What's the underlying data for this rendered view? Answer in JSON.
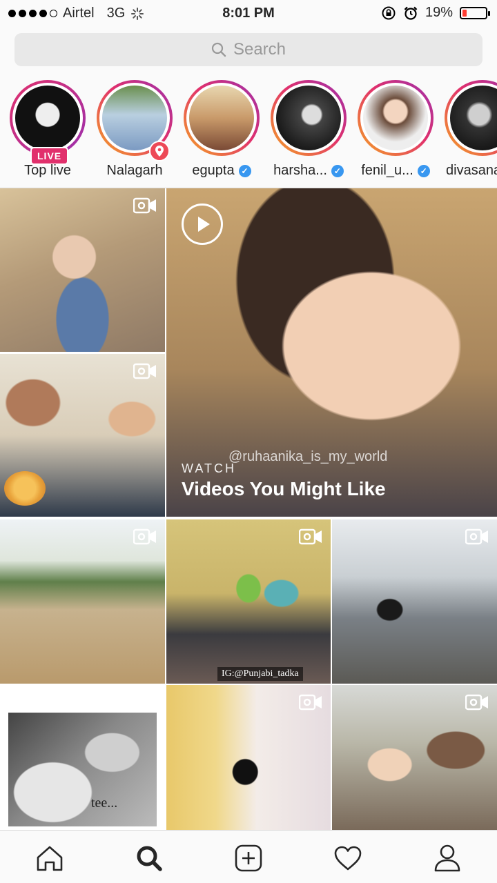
{
  "status_bar": {
    "carrier": "Airtel",
    "network": "3G",
    "time": "8:01 PM",
    "battery_percent": "19%",
    "battery_level": 0.19,
    "signal_bars_filled": 4,
    "signal_bars_total": 5
  },
  "search": {
    "placeholder": "Search"
  },
  "stories": [
    {
      "label": "Top live",
      "badge": "LIVE",
      "verified": false
    },
    {
      "label": "Nalagarh",
      "badge": "location-pin-icon",
      "verified": false
    },
    {
      "label": "egupta",
      "verified": true
    },
    {
      "label": "harsha...",
      "verified": true
    },
    {
      "label": "fenil_u...",
      "verified": true
    },
    {
      "label": "divasana",
      "verified": false
    }
  ],
  "grid": {
    "featured": {
      "kicker": "WATCH",
      "title": "Videos You Might Like",
      "watermark": "@ruhaanika_is_my_world"
    },
    "tile_tags": {
      "punjabi": "IG:@Punjabi_tadka",
      "dog_caption": "tee..."
    }
  },
  "tab_bar": {
    "icons": [
      "home-icon",
      "search-icon",
      "add-post-icon",
      "activity-heart-icon",
      "profile-icon"
    ],
    "active": "search-icon"
  },
  "colors": {
    "accent_pink": "#e1306c",
    "verified_blue": "#3897f0",
    "battery_red": "#ff3b30"
  }
}
